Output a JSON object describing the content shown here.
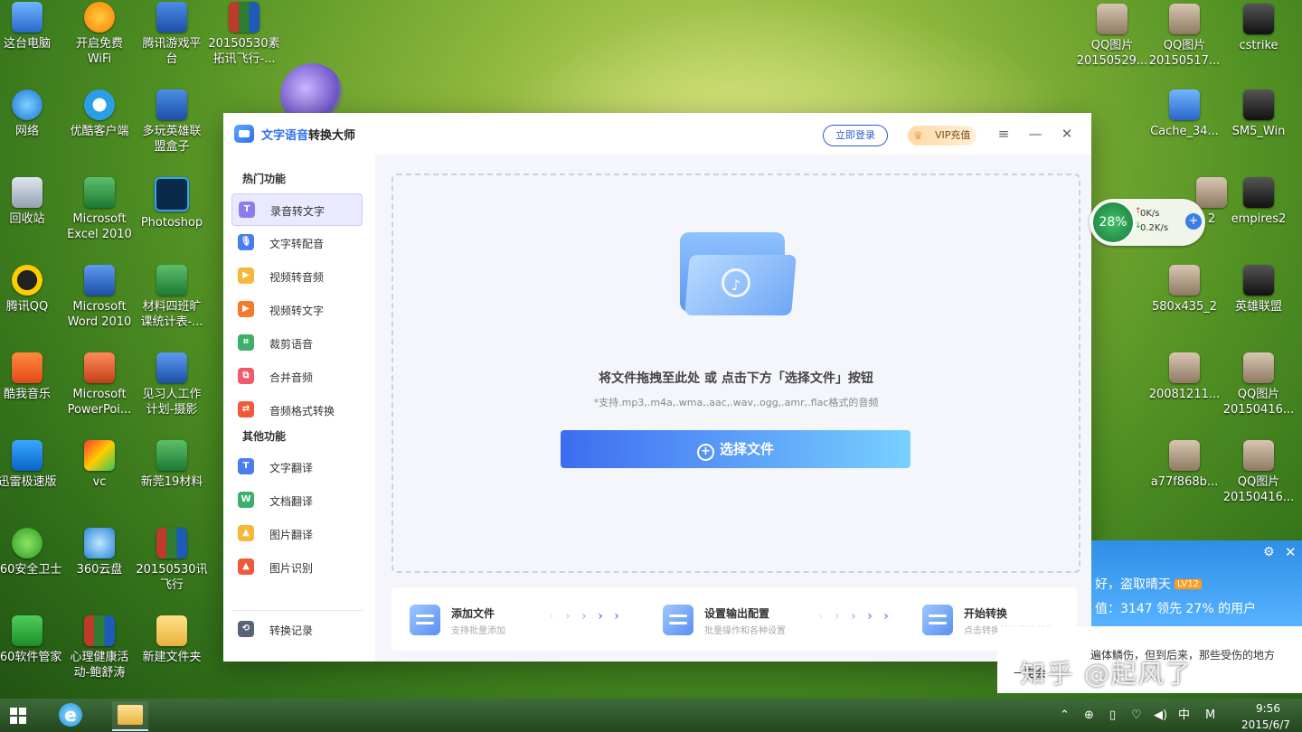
{
  "desktop": {
    "icons": [
      {
        "label_lines": [
          "这台电脑"
        ],
        "glyph": "monitor",
        "name": "this-pc-icon"
      },
      {
        "label_lines": [
          "开启免费",
          "WiFi"
        ],
        "glyph": "wifi",
        "name": "free-wifi-icon"
      },
      {
        "label_lines": [
          "腾讯游戏平",
          "台"
        ],
        "glyph": "shield",
        "name": "tencent-games-icon"
      },
      {
        "label_lines": [
          "20150530素",
          "拓讯飞行-..."
        ],
        "glyph": "rar",
        "name": "archive-icon"
      },
      {
        "label_lines": [
          "网络"
        ],
        "glyph": "earth",
        "name": "network-icon"
      },
      {
        "label_lines": [
          "优酷客户端"
        ],
        "glyph": "youku",
        "name": "youku-icon"
      },
      {
        "label_lines": [
          "多玩英雄联",
          "盟盒子"
        ],
        "glyph": "shield",
        "name": "duowan-lol-box-icon"
      },
      {
        "label_lines": [
          "回收站"
        ],
        "glyph": "trash",
        "name": "recycle-bin-icon"
      },
      {
        "label_lines": [
          "Microsoft",
          "Excel 2010"
        ],
        "glyph": "excel",
        "name": "excel-icon"
      },
      {
        "label_lines": [
          "Photoshop"
        ],
        "glyph": "ps",
        "name": "photoshop-icon"
      },
      {
        "label_lines": [
          "腾讯QQ"
        ],
        "glyph": "qq",
        "name": "qq-icon"
      },
      {
        "label_lines": [
          "Microsoft",
          "Word 2010"
        ],
        "glyph": "word",
        "name": "word-icon"
      },
      {
        "label_lines": [
          "材料四班旷",
          "课统计表-..."
        ],
        "glyph": "excel",
        "name": "excel-file-icon"
      },
      {
        "label_lines": [
          "酷我音乐"
        ],
        "glyph": "music",
        "name": "kuwo-music-icon"
      },
      {
        "label_lines": [
          "Microsoft",
          "PowerPoi..."
        ],
        "glyph": "ppt",
        "name": "powerpoint-icon"
      },
      {
        "label_lines": [
          "见习人工作",
          "计划-摄影"
        ],
        "glyph": "word",
        "name": "word-file-icon"
      },
      {
        "label_lines": [
          "迅雷极速版"
        ],
        "glyph": "xunlei",
        "name": "xunlei-icon"
      },
      {
        "label_lines": [
          "vc"
        ],
        "glyph": "vc",
        "name": "vc-icon"
      },
      {
        "label_lines": [
          "新莞19材料"
        ],
        "glyph": "excel",
        "name": "excel-file-2-icon"
      },
      {
        "label_lines": [
          "360安全卫士"
        ],
        "glyph": "s360",
        "name": "360-safe-icon"
      },
      {
        "label_lines": [
          "360云盘"
        ],
        "glyph": "cloud",
        "name": "360-cloud-icon"
      },
      {
        "label_lines": [
          "20150530讯",
          "飞行"
        ],
        "glyph": "rar",
        "name": "archive-2-icon"
      },
      {
        "label_lines": [
          "360软件管家"
        ],
        "glyph": "soft",
        "name": "360-software-icon"
      },
      {
        "label_lines": [
          "心理健康活",
          "动-鲍舒涛"
        ],
        "glyph": "rar",
        "name": "archive-3-icon"
      },
      {
        "label_lines": [
          "新建文件夹"
        ],
        "glyph": "folder",
        "name": "new-folder-icon"
      },
      {
        "label_lines": [
          "QQ图片",
          "20150529..."
        ],
        "glyph": "thumb",
        "name": "qq-image-1-icon"
      },
      {
        "label_lines": [
          "QQ图片",
          "20150517..."
        ],
        "glyph": "thumb",
        "name": "qq-image-2-icon"
      },
      {
        "label_lines": [
          "cstrike"
        ],
        "glyph": "cs",
        "name": "cstrike-icon"
      },
      {
        "label_lines": [
          "Cache_34..."
        ],
        "glyph": "monitor",
        "name": "cache-icon"
      },
      {
        "label_lines": [
          "SM5_Win"
        ],
        "glyph": "cs",
        "name": "sm5-icon"
      },
      {
        "label_lines": [
          "2"
        ],
        "glyph": "thumb",
        "name": "image-2-icon"
      },
      {
        "label_lines": [
          "empires2"
        ],
        "glyph": "cs",
        "name": "empires2-icon"
      },
      {
        "label_lines": [
          "580x435_2"
        ],
        "glyph": "thumb",
        "name": "image-580-icon"
      },
      {
        "label_lines": [
          "英雄联盟"
        ],
        "glyph": "cs",
        "name": "lol-icon"
      },
      {
        "label_lines": [
          "20081211..."
        ],
        "glyph": "thumb",
        "name": "image-2008-icon"
      },
      {
        "label_lines": [
          "QQ图片",
          "20150416..."
        ],
        "glyph": "thumb",
        "name": "qq-image-3-icon"
      },
      {
        "label_lines": [
          "a77f868b..."
        ],
        "glyph": "thumb",
        "name": "image-a77-icon"
      },
      {
        "label_lines": [
          "QQ图片",
          "20150416..."
        ],
        "glyph": "thumb",
        "name": "qq-image-4-icon"
      }
    ]
  },
  "app": {
    "title_prefix": "文字语音",
    "title_suffix": "转换大师",
    "login_label": "立即登录",
    "vip_label": "VIP充值",
    "menu_icon": "≡",
    "minimize_icon": "—",
    "close_icon": "✕",
    "sidebar": {
      "hot_heading": "热门功能",
      "other_heading": "其他功能",
      "hot_items": [
        {
          "label": "录音转文字",
          "icon_text": "T",
          "color": "#8c7cf0",
          "active": true,
          "name": "recording-to-text"
        },
        {
          "label": "文字转配音",
          "icon_text": "🎙",
          "color": "#4a7ef0",
          "active": false,
          "name": "text-to-voice"
        },
        {
          "label": "视频转音频",
          "icon_text": "▶",
          "color": "#f5b83a",
          "active": false,
          "name": "video-to-audio"
        },
        {
          "label": "视频转文字",
          "icon_text": "▶",
          "color": "#f57a2a",
          "active": false,
          "name": "video-to-text"
        },
        {
          "label": "裁剪语音",
          "icon_text": "⌗",
          "color": "#3cb06a",
          "active": false,
          "name": "trim-audio"
        },
        {
          "label": "合并音频",
          "icon_text": "⧉",
          "color": "#f05a6a",
          "active": false,
          "name": "merge-audio"
        },
        {
          "label": "音频格式转换",
          "icon_text": "⇄",
          "color": "#f05a3a",
          "active": false,
          "name": "audio-format-convert"
        }
      ],
      "other_items": [
        {
          "label": "文字翻译",
          "icon_text": "T",
          "color": "#4a7ef0",
          "name": "text-translate"
        },
        {
          "label": "文档翻译",
          "icon_text": "W",
          "color": "#3cb06a",
          "name": "doc-translate"
        },
        {
          "label": "图片翻译",
          "icon_text": "▲",
          "color": "#f5b83a",
          "name": "image-translate"
        },
        {
          "label": "图片识别",
          "icon_text": "▲",
          "color": "#f05a3a",
          "name": "image-recognize"
        }
      ],
      "history_label": "转换记录",
      "history_icon": "⟲"
    },
    "dropzone": {
      "title": "将文件拖拽至此处 或 点击下方「选择文件」按钮",
      "subtitle": "*支持.mp3,.m4a,.wma,.aac,.wav,.ogg,.amr,.flac格式的音频",
      "choose_button": "选择文件",
      "plus_icon": "+"
    },
    "steps": [
      {
        "title": "添加文件",
        "sub": "支持批量添加",
        "name": "step-add-files"
      },
      {
        "title": "设置输出配置",
        "sub": "批量操作和各种设置",
        "name": "step-output-settings"
      },
      {
        "title": "开始转换",
        "sub": "点击转换按钮开始转换",
        "name": "step-start-convert"
      }
    ],
    "arrow_glyphs": "› › › › ›"
  },
  "net_widget": {
    "percent": "28%",
    "up": "0K/s",
    "down": "0.2K/s",
    "plus": "+"
  },
  "weather": {
    "line1_prefix": "好，盗取晴天",
    "level_badge": "LV12",
    "line2": "值：3147   领先 27% 的用户",
    "gear": "⚙",
    "close": "✕"
  },
  "news": {
    "text": "遍体鳞伤，但到后来，那些受伤的地方",
    "more": "一定会"
  },
  "watermark": "知乎 @起风了",
  "taskbar": {
    "ie_glyph": "e",
    "tray": [
      "⌃",
      "⊕",
      "▯",
      "♡",
      "◀)",
      "中",
      "M"
    ],
    "time": "9:56",
    "date": "2015/6/7"
  }
}
